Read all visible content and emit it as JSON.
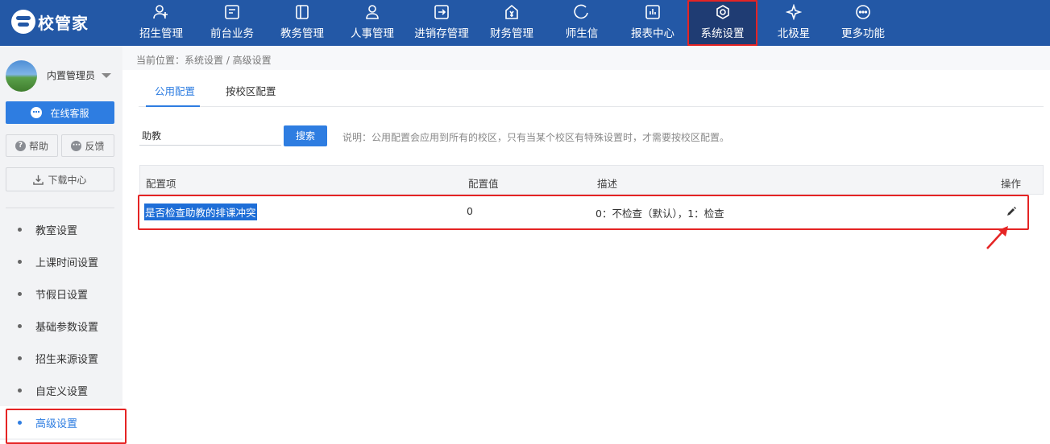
{
  "logo": {
    "text": "校管家"
  },
  "nav": [
    {
      "key": "enroll",
      "label": "招生管理",
      "icon": "user-plus-icon"
    },
    {
      "key": "frontdesk",
      "label": "前台业务",
      "icon": "monitor-icon"
    },
    {
      "key": "academic",
      "label": "教务管理",
      "icon": "book-icon"
    },
    {
      "key": "hr",
      "label": "人事管理",
      "icon": "person-icon"
    },
    {
      "key": "inventory",
      "label": "进销存管理",
      "icon": "box-arrow-icon"
    },
    {
      "key": "finance",
      "label": "财务管理",
      "icon": "money-icon"
    },
    {
      "key": "message",
      "label": "师生信",
      "icon": "chat-icon"
    },
    {
      "key": "reports",
      "label": "报表中心",
      "icon": "chart-icon"
    },
    {
      "key": "settings",
      "label": "系统设置",
      "icon": "gear-icon",
      "active": true
    },
    {
      "key": "polaris",
      "label": "北极星",
      "icon": "star-icon"
    },
    {
      "key": "more",
      "label": "更多功能",
      "icon": "more-icon"
    }
  ],
  "user": {
    "name": "内置管理员"
  },
  "sidebar": {
    "service_label": "在线客服",
    "help_label": "帮助",
    "feedback_label": "反馈",
    "download_label": "下载中心",
    "items": [
      {
        "label": "教室设置"
      },
      {
        "label": "上课时间设置"
      },
      {
        "label": "节假日设置"
      },
      {
        "label": "基础参数设置"
      },
      {
        "label": "招生来源设置"
      },
      {
        "label": "自定义设置"
      },
      {
        "label": "高级设置",
        "active": true
      }
    ]
  },
  "breadcrumb": "当前位置：系统设置 / 高级设置",
  "tabs": [
    {
      "label": "公用配置",
      "active": true
    },
    {
      "label": "按校区配置"
    }
  ],
  "search": {
    "value": "助教",
    "button": "搜索"
  },
  "note": "说明：公用配置会应用到所有的校区，只有当某个校区有特殊设置时，才需要按校区配置。",
  "table": {
    "headers": [
      "配置项",
      "配置值",
      "描述",
      "操作"
    ],
    "rows": [
      {
        "item": "是否检查助教的排课冲突",
        "value": "0",
        "desc": "0：不检查（默认），1：检查"
      }
    ]
  },
  "colors": {
    "nav_bg": "#2358a6",
    "accent": "#2e7de1",
    "highlight_border": "#e52424"
  }
}
